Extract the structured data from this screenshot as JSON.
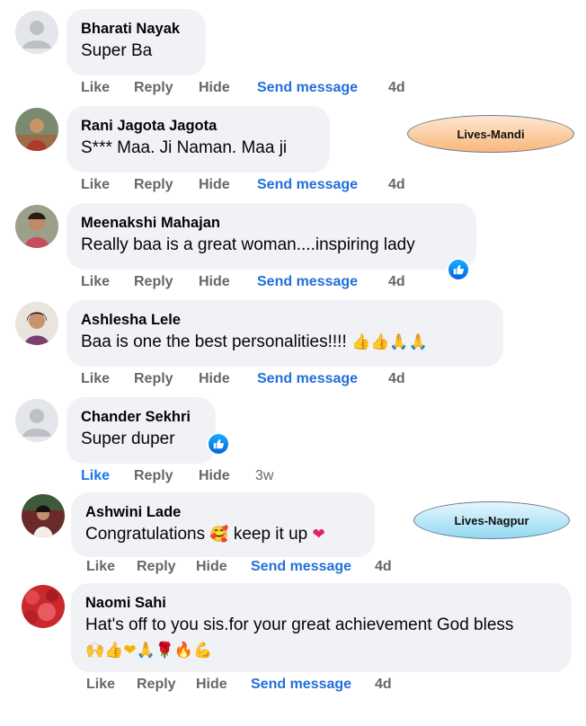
{
  "comments": [
    {
      "author": "Bharati Nayak",
      "text": "Super Ba",
      "actions": {
        "like": "Like",
        "reply": "Reply",
        "hide": "Hide",
        "send": "Send message",
        "time": "4d"
      },
      "avatar": "default-avatar"
    },
    {
      "author": "Rani Jagota Jagota",
      "text": "S*** Maa. Ji Naman. Maa ji",
      "actions": {
        "like": "Like",
        "reply": "Reply",
        "hide": "Hide",
        "send": "Send message",
        "time": "4d"
      },
      "avatar": "photo-avatar"
    },
    {
      "author": "Meenakshi Mahajan",
      "text": "Really baa is a great woman....inspiring lady",
      "actions": {
        "like": "Like",
        "reply": "Reply",
        "hide": "Hide",
        "send": "Send message",
        "time": "4d"
      },
      "avatar": "photo-avatar",
      "reaction": "like-icon"
    },
    {
      "author": "Ashlesha Lele",
      "text": "Baa is one the best personalities!!!!",
      "emojis": "👍👍🙏🙏",
      "actions": {
        "like": "Like",
        "reply": "Reply",
        "hide": "Hide",
        "send": "Send message",
        "time": "4d"
      },
      "avatar": "photo-avatar"
    },
    {
      "author": "Chander Sekhri",
      "text": "Super duper",
      "actions": {
        "like": "Like",
        "reply": "Reply",
        "hide": "Hide",
        "time": "3w"
      },
      "avatar": "default-avatar",
      "reaction": "like-icon",
      "liked": true
    },
    {
      "author": "Ashwini Lade",
      "text": "Congratulations",
      "emoji_mid": "🥰",
      "text_after": "keep it up",
      "emoji_end": "❤",
      "actions": {
        "like": "Like",
        "reply": "Reply",
        "hide": "Hide",
        "send": "Send message",
        "time": "4d"
      },
      "avatar": "photo-avatar"
    },
    {
      "author": "Naomi Sahi",
      "text": "Hat's off to you sis.for your great achievement God bless",
      "emojis": "🙌👍❤🙏🌹🔥💪",
      "actions": {
        "like": "Like",
        "reply": "Reply",
        "hide": "Hide",
        "send": "Send message",
        "time": "4d"
      },
      "avatar": "photo-avatar"
    }
  ],
  "annotations": {
    "mandi": "Lives-Mandi",
    "nagpur": "Lives-Nagpur"
  },
  "colors": {
    "bubble": "#f0f2f5",
    "send_message": "#216fdb",
    "action_gray": "#65676b",
    "like_blue": "#1877f2"
  }
}
